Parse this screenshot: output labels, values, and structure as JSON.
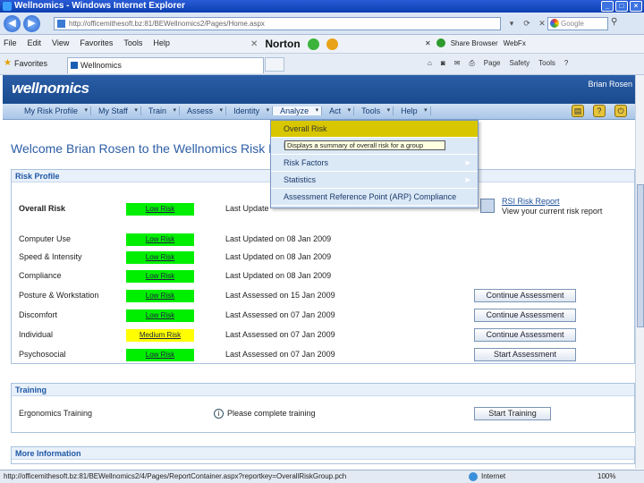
{
  "browser": {
    "window_title": "Wellnomics - Windows Internet Explorer",
    "url": "http://officemithesoft.bz:81/BEWellnomics2/Pages/Home.aspx",
    "search_placeholder": "Google",
    "menus": [
      "File",
      "Edit",
      "View",
      "Favorites",
      "Tools",
      "Help"
    ],
    "norton_label": "Norton",
    "share_label": "Share Browser",
    "webfx_label": "WebFx",
    "favorites_label": "Favorites",
    "tab_title": "Wellnomics",
    "toolbar_items": [
      "Page",
      "Safety",
      "Tools"
    ],
    "status_url": "http://officemithesoft.bz:81/BEWellnomics2/4/Pages/ReportContainer.aspx?reportkey=OverallRiskGroup.pch",
    "zone": "Internet",
    "zoom": "100%"
  },
  "app": {
    "logo": "wellnomics",
    "user_name": "Brian Rosen",
    "nav": [
      "My Risk Profile",
      "My Staff",
      "Train",
      "Assess",
      "Identity",
      "Analyze",
      "Act",
      "Tools",
      "Help"
    ],
    "welcome": "Welcome Brian Rosen to the Wellnomics Risk M"
  },
  "dropdown": {
    "items": [
      {
        "label": "Overall Risk",
        "highlight": true,
        "submenu": false
      },
      {
        "label": "Risk",
        "highlight": false,
        "submenu": false
      },
      {
        "label": "Risk Factors",
        "highlight": false,
        "submenu": true
      },
      {
        "label": "Statistics",
        "highlight": false,
        "submenu": true
      },
      {
        "label": "Assessment Reference Point (ARP) Compliance",
        "highlight": false,
        "submenu": false
      }
    ],
    "tooltip": "Displays a summary of overall risk for a group"
  },
  "risk_profile": {
    "title": "Risk Profile",
    "rsi_link": "RSI Risk Report",
    "rsi_desc": "View your current risk report",
    "rows": [
      {
        "name": "Overall Risk",
        "level": "Low Risk",
        "kind": "low",
        "updated": "Last Update",
        "action": ""
      },
      {
        "name": "Computer Use",
        "level": "Low Risk",
        "kind": "low",
        "updated": "Last Updated on 08 Jan 2009",
        "action": ""
      },
      {
        "name": "Speed & Intensity",
        "level": "Low Risk",
        "kind": "low",
        "updated": "Last Updated on 08 Jan 2009",
        "action": ""
      },
      {
        "name": "Compliance",
        "level": "Low Risk",
        "kind": "low",
        "updated": "Last Updated on 08 Jan 2009",
        "action": ""
      },
      {
        "name": "Posture & Workstation",
        "level": "Low Risk",
        "kind": "low",
        "updated": "Last Assessed on 15 Jan 2009",
        "action": "Continue Assessment"
      },
      {
        "name": "Discomfort",
        "level": "Low Risk",
        "kind": "low",
        "updated": "Last Assessed on 07 Jan 2009",
        "action": "Continue Assessment"
      },
      {
        "name": "Individual",
        "level": "Medium Risk",
        "kind": "med",
        "updated": "Last Assessed on 07 Jan 2009",
        "action": "Continue Assessment"
      },
      {
        "name": "Psychosocial",
        "level": "Low Risk",
        "kind": "low",
        "updated": "Last Assessed on 07 Jan 2009",
        "action": "Start Assessment"
      }
    ]
  },
  "training": {
    "title": "Training",
    "row": "Ergonomics Training",
    "info": "Please complete training",
    "action": "Start Training"
  },
  "more": {
    "title": "More Information"
  }
}
